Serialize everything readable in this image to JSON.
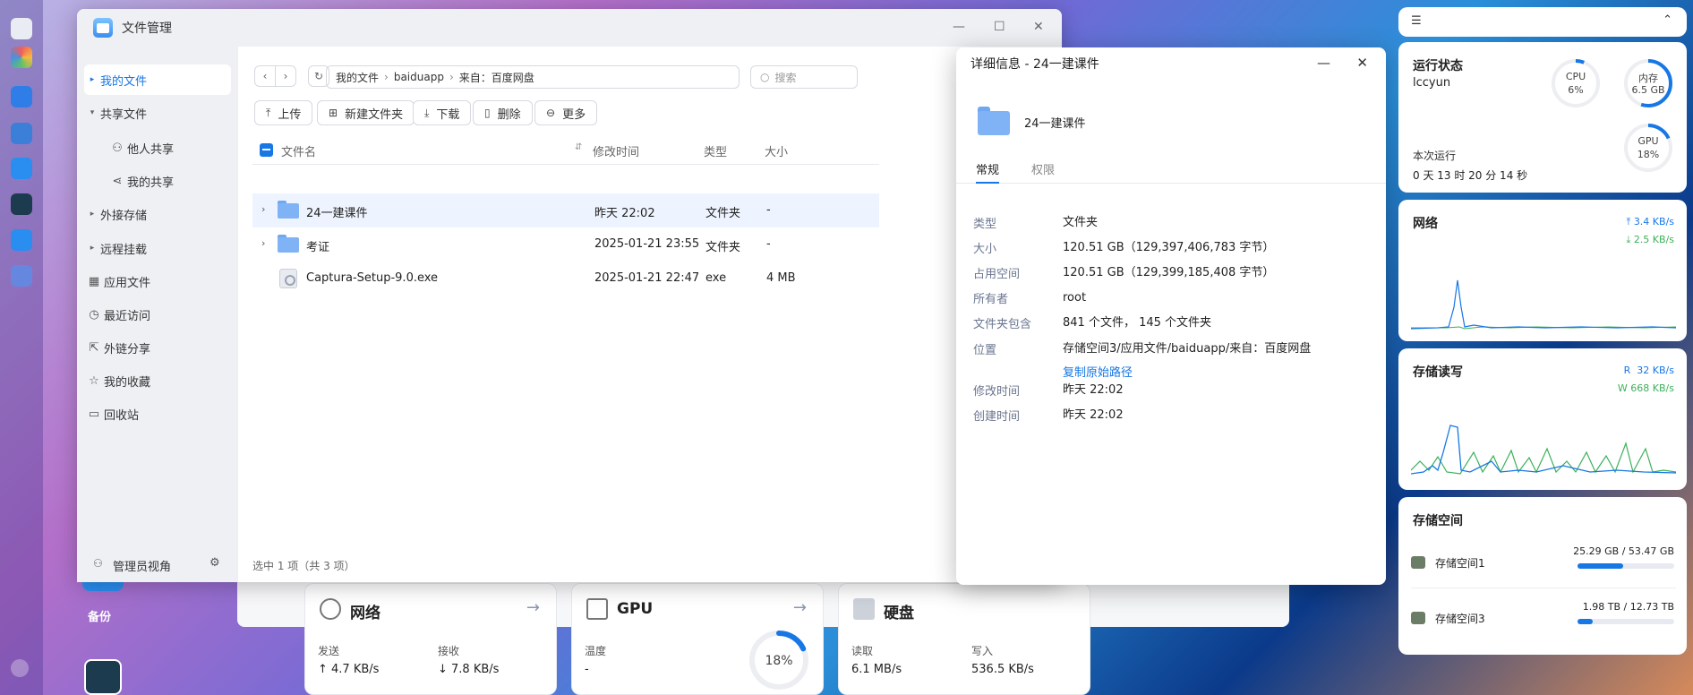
{
  "dock": {
    "items": [
      "monitor-icon",
      "apps-icon",
      "storage-icon",
      "screen-icon",
      "files-icon",
      "monitor-app-icon",
      "files2-icon",
      "folder-icon"
    ]
  },
  "file_manager": {
    "title": "文件管理",
    "sidebar": [
      {
        "label": "我的文件",
        "active": true
      },
      {
        "label": "共享文件"
      },
      {
        "label": "他人共享"
      },
      {
        "label": "我的共享"
      },
      {
        "label": "外接存储"
      },
      {
        "label": "远程挂载"
      },
      {
        "label": "应用文件"
      },
      {
        "label": "最近访问"
      },
      {
        "label": "外链分享"
      },
      {
        "label": "我的收藏"
      },
      {
        "label": "回收站"
      }
    ],
    "admin_view": "管理员视角",
    "path": [
      "我的文件",
      "baiduapp",
      "来自：百度网盘"
    ],
    "search_placeholder": "搜索",
    "toolbar": {
      "upload": "上传",
      "new_folder": "新建文件夹",
      "download": "下载",
      "delete": "删除",
      "more": "更多"
    },
    "columns": {
      "name": "文件名",
      "modified": "修改时间",
      "type": "类型",
      "size": "大小"
    },
    "rows": [
      {
        "name": "24一建课件",
        "modified": "昨天 22:02",
        "type": "文件夹",
        "size": "-"
      },
      {
        "name": "考证",
        "modified": "2025-01-21 23:55",
        "type": "文件夹",
        "size": "-"
      },
      {
        "name": "Captura-Setup-9.0.exe",
        "modified": "2025-01-21 22:47",
        "type": "exe",
        "size": "4 MB"
      }
    ],
    "status": "选中 1 项（共 3 项）"
  },
  "details": {
    "title": "详细信息 - 24一建课件",
    "name": "24一建课件",
    "tabs": [
      "常规",
      "权限"
    ],
    "fields": [
      {
        "k": "类型",
        "v": "文件夹"
      },
      {
        "k": "大小",
        "v": "120.51 GB（129,397,406,783 字节）"
      },
      {
        "k": "占用空间",
        "v": "120.51 GB（129,399,185,408 字节）"
      },
      {
        "k": "所有者",
        "v": "root"
      },
      {
        "k": "文件夹包含",
        "v": "841 个文件， 145 个文件夹"
      },
      {
        "k": "位置",
        "v": "存储空间3/应用文件/baiduapp/来自：百度网盘"
      },
      {
        "k": "修改时间",
        "v": "昨天 22:02"
      },
      {
        "k": "创建时间",
        "v": "昨天 22:02"
      }
    ],
    "copy_path": "复制原始路径"
  },
  "dashboard": {
    "backup_label": "备份",
    "network": {
      "title": "网络",
      "send_label": "发送",
      "send": "↑ 4.7 KB/s",
      "recv_label": "接收",
      "recv": "↓ 7.8 KB/s"
    },
    "gpu": {
      "title": "GPU",
      "temp_label": "温度",
      "temp": "-",
      "usage": "18%",
      "usage_value": 18
    },
    "disk": {
      "title": "硬盘",
      "read_label": "读取",
      "read": "6.1 MB/s",
      "write_label": "写入",
      "write": "536.5 KB/s"
    }
  },
  "widgets": {
    "status": {
      "title": "运行状态",
      "host": "lccyun",
      "uptime_label": "本次运行",
      "uptime": "0 天 13 时 20 分 14 秒",
      "cpu_label": "CPU",
      "cpu": "6%",
      "cpu_value": 6,
      "mem_label": "内存",
      "mem": "6.5 GB",
      "mem_value": 0.55,
      "gpu_label": "GPU",
      "gpu": "18%",
      "gpu_value": 18
    },
    "network": {
      "title": "网络",
      "up": "3.4 KB/s",
      "down": "2.5 KB/s"
    },
    "io": {
      "title": "存储读写",
      "read_prefix": "R",
      "read": "32 KB/s",
      "write_prefix": "W",
      "write": "668 KB/s"
    },
    "storage": {
      "title": "存储空间",
      "volumes": [
        {
          "name": "存储空间1",
          "usage": "25.29 GB / 53.47 GB",
          "fraction": 0.47
        },
        {
          "name": "存储空间3",
          "usage": "1.98 TB / 12.73 TB",
          "fraction": 0.16
        }
      ]
    }
  },
  "colors": {
    "accent": "#1677e5",
    "green": "#3db05a",
    "folder": "#7fb3f5"
  }
}
